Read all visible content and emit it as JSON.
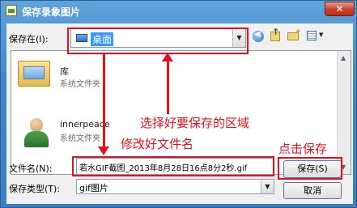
{
  "window": {
    "title": "保存录象图片",
    "close_glyph": "✕"
  },
  "toolbar": {
    "save_in_label": "保存在(I):",
    "location": "桌面"
  },
  "items": [
    {
      "name": "库",
      "type": "系统文件夹"
    },
    {
      "name": "innerpeace",
      "type": "系统文件夹"
    }
  ],
  "form": {
    "filename_label": "文件名(N):",
    "filename_value": "若水GIF截图_2013年8月28日16点8分2秒.gif",
    "filetype_label": "保存类型(T):",
    "filetype_value": "gif图片",
    "save_button": "保存(S)",
    "cancel_button": "取消"
  },
  "annotations": {
    "choose_area": "选择好要保存的区域",
    "rename": "修改好文件名",
    "click_save": "点击保存"
  },
  "colors": {
    "annotation": "#e8101c",
    "title_bar": "#3f86c6"
  }
}
